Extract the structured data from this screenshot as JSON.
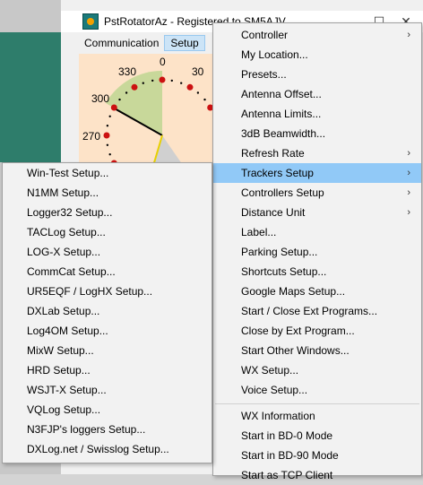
{
  "window": {
    "title": "PstRotatorAz - Registered to SM5AJV",
    "minimize_glyph": "—",
    "maximize_glyph": "☐",
    "close_glyph": "✕"
  },
  "menubar": {
    "items": [
      "Communication",
      "Setup"
    ]
  },
  "dial": {
    "labels": [
      "330",
      "0",
      "30",
      "300",
      "270"
    ],
    "bearing_deg": 295
  },
  "setup_menu": {
    "items": [
      {
        "label": "Controller",
        "submenu": true
      },
      {
        "label": "My Location...",
        "submenu": false
      },
      {
        "label": "Presets...",
        "submenu": false
      },
      {
        "label": "Antenna Offset...",
        "submenu": false
      },
      {
        "label": "Antenna Limits...",
        "submenu": false
      },
      {
        "label": "3dB Beamwidth...",
        "submenu": false
      },
      {
        "label": "Refresh Rate",
        "submenu": true
      },
      {
        "label": "Trackers Setup",
        "submenu": true
      },
      {
        "label": "Controllers Setup",
        "submenu": true
      },
      {
        "label": "Distance Unit",
        "submenu": true
      },
      {
        "label": "Label...",
        "submenu": false
      },
      {
        "label": "Parking Setup...",
        "submenu": false
      },
      {
        "label": "Shortcuts Setup...",
        "submenu": false
      },
      {
        "label": "Google Maps Setup...",
        "submenu": false
      },
      {
        "label": "Start / Close Ext Programs...",
        "submenu": false
      },
      {
        "label": "Close by Ext Program...",
        "submenu": false
      },
      {
        "label": "Start Other Windows...",
        "submenu": false
      },
      {
        "label": "WX Setup...",
        "submenu": false
      },
      {
        "label": "Voice Setup...",
        "submenu": false
      },
      {
        "label": "WX Information",
        "submenu": false
      },
      {
        "label": "Start in BD-0 Mode",
        "submenu": false
      },
      {
        "label": "Start in BD-90 Mode",
        "submenu": false
      },
      {
        "label": "Start as TCP Client",
        "submenu": false
      }
    ],
    "highlighted": "Trackers Setup",
    "submenu_arrow": "›"
  },
  "trackers_menu": {
    "items": [
      "Win-Test Setup...",
      "N1MM Setup...",
      "Logger32 Setup...",
      "TACLog Setup...",
      "LOG-X Setup...",
      "CommCat Setup...",
      "UR5EQF / LogHX Setup...",
      "DXLab Setup...",
      "Log4OM Setup...",
      "MixW Setup...",
      "HRD Setup...",
      "WSJT-X Setup...",
      "VQLog Setup...",
      "N3FJP's loggers Setup...",
      "DXLog.net / Swisslog Setup..."
    ]
  },
  "colors": {
    "highlight": "#91c9f7",
    "menu_bg": "#f2f2f2",
    "dial_bg": "#fde3c8",
    "beam": "#c8d89a",
    "dot": "#cc1111"
  }
}
